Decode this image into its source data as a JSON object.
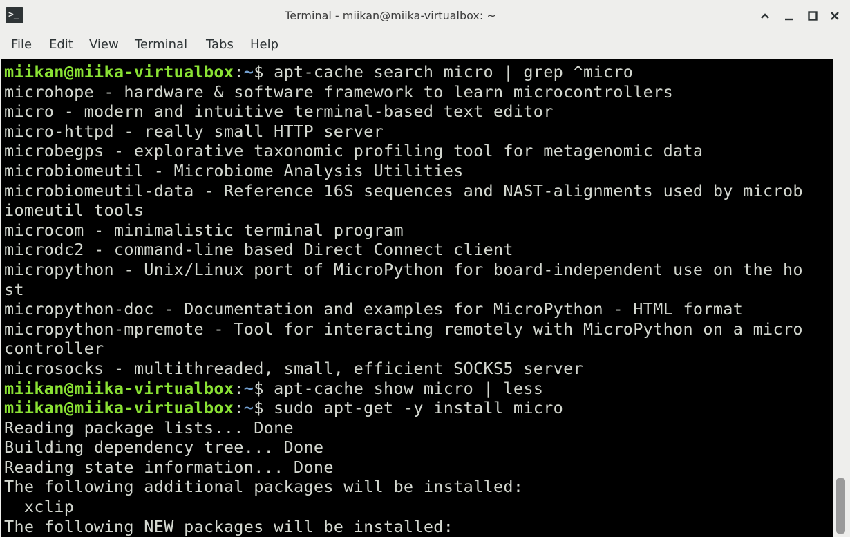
{
  "window": {
    "title": "Terminal - miikan@miika-virtualbox: ~",
    "app_icon": "terminal-icon",
    "app_icon_glyph": ">_",
    "controls": [
      "chevron-up-icon",
      "minimize-icon",
      "maximize-icon",
      "close-icon"
    ]
  },
  "menu": {
    "items": [
      "File",
      "Edit",
      "View",
      "Terminal",
      "Tabs",
      "Help"
    ]
  },
  "prompt": {
    "user_host": "miikan@miika-virtualbox",
    "colon": ":",
    "path": "~",
    "symbol": "$ "
  },
  "terminal": {
    "lines": [
      {
        "type": "prompt",
        "command": "apt-cache search micro | grep ^micro"
      },
      {
        "type": "output",
        "text": "microhope - hardware & software framework to learn microcontrollers"
      },
      {
        "type": "output",
        "text": "micro - modern and intuitive terminal-based text editor"
      },
      {
        "type": "output",
        "text": "micro-httpd - really small HTTP server"
      },
      {
        "type": "output",
        "text": "microbegps - explorative taxonomic profiling tool for metagenomic data"
      },
      {
        "type": "output",
        "text": "microbiomeutil - Microbiome Analysis Utilities"
      },
      {
        "type": "output",
        "text": "microbiomeutil-data - Reference 16S sequences and NAST-alignments used by microb"
      },
      {
        "type": "output",
        "text": "iomeutil tools"
      },
      {
        "type": "output",
        "text": "microcom - minimalistic terminal program"
      },
      {
        "type": "output",
        "text": "microdc2 - command-line based Direct Connect client"
      },
      {
        "type": "output",
        "text": "micropython - Unix/Linux port of MicroPython for board-independent use on the ho"
      },
      {
        "type": "output",
        "text": "st"
      },
      {
        "type": "output",
        "text": "micropython-doc - Documentation and examples for MicroPython - HTML format"
      },
      {
        "type": "output",
        "text": "micropython-mpremote - Tool for interacting remotely with MicroPython on a micro"
      },
      {
        "type": "output",
        "text": "controller"
      },
      {
        "type": "output",
        "text": "microsocks - multithreaded, small, efficient SOCKS5 server"
      },
      {
        "type": "prompt",
        "command": "apt-cache show micro | less"
      },
      {
        "type": "prompt",
        "command": "sudo apt-get -y install micro"
      },
      {
        "type": "output",
        "text": "Reading package lists... Done"
      },
      {
        "type": "output",
        "text": "Building dependency tree... Done"
      },
      {
        "type": "output",
        "text": "Reading state information... Done"
      },
      {
        "type": "output",
        "text": "The following additional packages will be installed:"
      },
      {
        "type": "output",
        "text": "  xclip"
      },
      {
        "type": "output",
        "text": "The following NEW packages will be installed:"
      }
    ]
  }
}
